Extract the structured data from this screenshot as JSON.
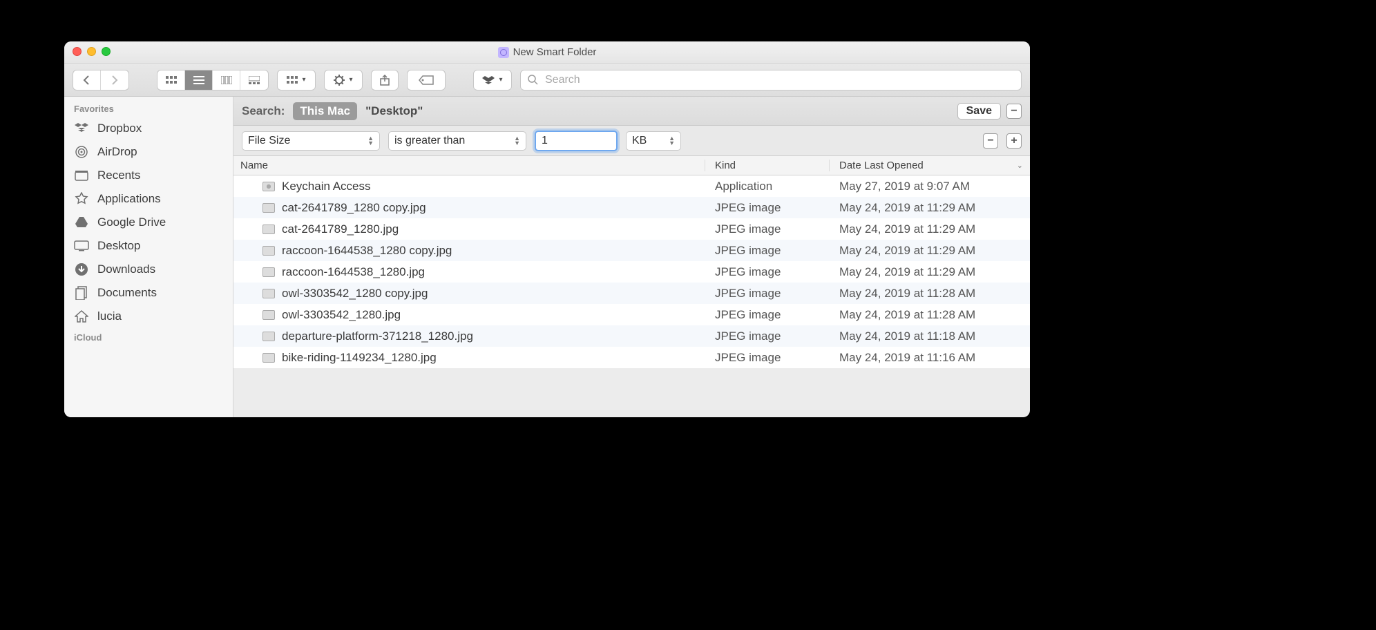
{
  "window": {
    "title": "New Smart Folder"
  },
  "toolbar": {
    "search_placeholder": "Search"
  },
  "sidebar": {
    "sections": [
      {
        "header": "Favorites",
        "items": [
          {
            "label": "Dropbox",
            "icon": "dropbox-icon"
          },
          {
            "label": "AirDrop",
            "icon": "airdrop-icon"
          },
          {
            "label": "Recents",
            "icon": "recents-icon"
          },
          {
            "label": "Applications",
            "icon": "applications-icon"
          },
          {
            "label": "Google Drive",
            "icon": "googledrive-icon"
          },
          {
            "label": "Desktop",
            "icon": "desktop-icon"
          },
          {
            "label": "Downloads",
            "icon": "downloads-icon"
          },
          {
            "label": "Documents",
            "icon": "documents-icon"
          },
          {
            "label": "lucia",
            "icon": "home-icon"
          }
        ]
      },
      {
        "header": "iCloud",
        "items": []
      }
    ]
  },
  "scope": {
    "label": "Search:",
    "active": "This Mac",
    "alt": "\"Desktop\"",
    "save": "Save"
  },
  "criteria": {
    "attribute": "File Size",
    "operator": "is greater than",
    "value": "1",
    "unit": "KB"
  },
  "columns": {
    "name": "Name",
    "kind": "Kind",
    "date": "Date Last Opened"
  },
  "rows": [
    {
      "name": "Keychain Access",
      "kind": "Application",
      "date": "May 27, 2019 at 9:07 AM",
      "app": true
    },
    {
      "name": "cat-2641789_1280 copy.jpg",
      "kind": "JPEG image",
      "date": "May 24, 2019 at 11:29 AM"
    },
    {
      "name": "cat-2641789_1280.jpg",
      "kind": "JPEG image",
      "date": "May 24, 2019 at 11:29 AM"
    },
    {
      "name": "raccoon-1644538_1280 copy.jpg",
      "kind": "JPEG image",
      "date": "May 24, 2019 at 11:29 AM"
    },
    {
      "name": "raccoon-1644538_1280.jpg",
      "kind": "JPEG image",
      "date": "May 24, 2019 at 11:29 AM"
    },
    {
      "name": "owl-3303542_1280 copy.jpg",
      "kind": "JPEG image",
      "date": "May 24, 2019 at 11:28 AM"
    },
    {
      "name": "owl-3303542_1280.jpg",
      "kind": "JPEG image",
      "date": "May 24, 2019 at 11:28 AM"
    },
    {
      "name": "departure-platform-371218_1280.jpg",
      "kind": "JPEG image",
      "date": "May 24, 2019 at 11:18 AM"
    },
    {
      "name": "bike-riding-1149234_1280.jpg",
      "kind": "JPEG image",
      "date": "May 24, 2019 at 11:16 AM"
    }
  ]
}
